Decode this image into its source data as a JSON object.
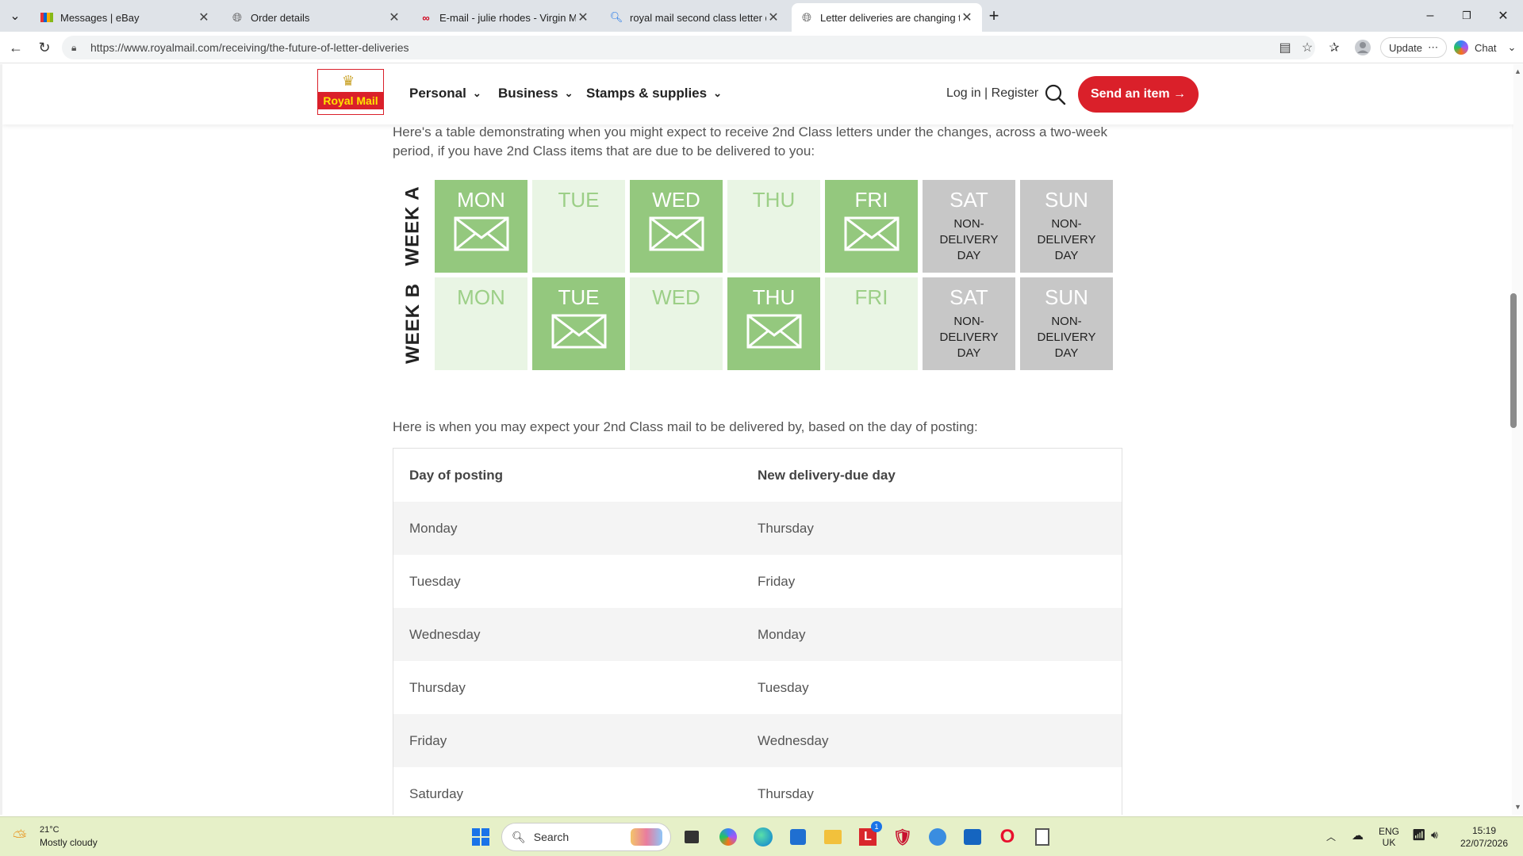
{
  "browser": {
    "tabs": [
      {
        "label": "Messages | eBay",
        "icon": "ebay-icon",
        "active": false
      },
      {
        "label": "Order details",
        "icon": "globe-icon",
        "active": false
      },
      {
        "label": "E-mail - julie rhodes - Virgin Medi",
        "icon": "virgin-media-icon",
        "active": false
      },
      {
        "label": "royal mail second class letter deliv",
        "icon": "search-icon",
        "active": false
      },
      {
        "label": "Letter deliveries are changing to d",
        "icon": "globe-icon",
        "active": true
      }
    ],
    "url": "https://www.royalmail.com/receiving/the-future-of-letter-deliveries",
    "update_label": "Update",
    "chat_label": "Chat"
  },
  "site": {
    "logo_text": "Royal Mail",
    "nav": [
      "Personal",
      "Business",
      "Stamps & supplies"
    ],
    "login": "Log in | Register",
    "send_button": "Send an item →"
  },
  "content": {
    "intro": "Here's a table demonstrating when you might expect to receive 2nd Class letters under the changes, across a two-week period, if you have 2nd Class items that are due to be delivered to you:",
    "calendar": {
      "weeks": [
        {
          "label": "WEEK A",
          "days": [
            {
              "day": "MON",
              "status": "delivery"
            },
            {
              "day": "TUE",
              "status": "none"
            },
            {
              "day": "WED",
              "status": "delivery"
            },
            {
              "day": "THU",
              "status": "none"
            },
            {
              "day": "FRI",
              "status": "delivery"
            },
            {
              "day": "SAT",
              "status": "non-delivery"
            },
            {
              "day": "SUN",
              "status": "non-delivery"
            }
          ]
        },
        {
          "label": "WEEK B",
          "days": [
            {
              "day": "MON",
              "status": "none"
            },
            {
              "day": "TUE",
              "status": "delivery"
            },
            {
              "day": "WED",
              "status": "none"
            },
            {
              "day": "THU",
              "status": "delivery"
            },
            {
              "day": "FRI",
              "status": "none"
            },
            {
              "day": "SAT",
              "status": "non-delivery"
            },
            {
              "day": "SUN",
              "status": "non-delivery"
            }
          ]
        }
      ],
      "non_delivery_text": [
        "NON-",
        "DELIVERY",
        "DAY"
      ],
      "colors": {
        "delivery": "#94c87e",
        "none": "#e9f5e4",
        "non_delivery": "#c7c7c7"
      }
    },
    "table_intro": "Here is when you may expect your 2nd Class mail to be delivered by, based on the day of posting:",
    "table": {
      "headers": [
        "Day of posting",
        "New delivery-due day"
      ],
      "rows": [
        [
          "Monday",
          "Thursday"
        ],
        [
          "Tuesday",
          "Friday"
        ],
        [
          "Wednesday",
          "Monday"
        ],
        [
          "Thursday",
          "Tuesday"
        ],
        [
          "Friday",
          "Wednesday"
        ],
        [
          "Saturday",
          "Thursday"
        ]
      ]
    }
  },
  "taskbar": {
    "weather_temp": "21°C",
    "weather_desc": "Mostly cloudy",
    "search_placeholder": "Search",
    "mail_badge": "1",
    "lang": "ENG",
    "region": "UK",
    "time": "15:19",
    "date": "22/07/2026"
  }
}
